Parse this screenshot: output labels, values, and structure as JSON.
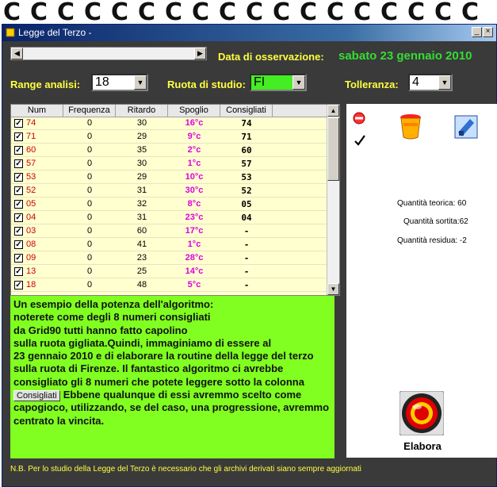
{
  "window": {
    "title": "Legge del Terzo -"
  },
  "header": {
    "date_label": "Data di osservazione:",
    "date_value": "sabato 23 gennaio 2010"
  },
  "controls": {
    "range_label": "Range analisi:",
    "range_value": "18",
    "ruota_label": "Ruota di studio:",
    "ruota_value": "FI",
    "tolleranza_label": "Tolleranza:",
    "tolleranza_value": "4"
  },
  "table": {
    "columns": [
      "Num",
      "Frequenza",
      "Ritardo",
      "Spoglio",
      "Consigliati"
    ],
    "rows": [
      {
        "num": "74",
        "freq": "0",
        "rit": "30",
        "spo": "16°c",
        "con": "74"
      },
      {
        "num": "71",
        "freq": "0",
        "rit": "29",
        "spo": "9°c",
        "con": "71"
      },
      {
        "num": "60",
        "freq": "0",
        "rit": "35",
        "spo": "2°c",
        "con": "60"
      },
      {
        "num": "57",
        "freq": "0",
        "rit": "30",
        "spo": "1°c",
        "con": "57"
      },
      {
        "num": "53",
        "freq": "0",
        "rit": "29",
        "spo": "10°c",
        "con": "53"
      },
      {
        "num": "52",
        "freq": "0",
        "rit": "31",
        "spo": "30°c",
        "con": "52"
      },
      {
        "num": "05",
        "freq": "0",
        "rit": "32",
        "spo": "8°c",
        "con": "05"
      },
      {
        "num": "04",
        "freq": "0",
        "rit": "31",
        "spo": "23°c",
        "con": "04"
      },
      {
        "num": "03",
        "freq": "0",
        "rit": "60",
        "spo": "17°c",
        "con": "-"
      },
      {
        "num": "08",
        "freq": "0",
        "rit": "41",
        "spo": "1°c",
        "con": "-"
      },
      {
        "num": "09",
        "freq": "0",
        "rit": "23",
        "spo": "28°c",
        "con": "-"
      },
      {
        "num": "13",
        "freq": "0",
        "rit": "25",
        "spo": "14°c",
        "con": "-"
      },
      {
        "num": "18",
        "freq": "0",
        "rit": "48",
        "spo": "5°c",
        "con": "-"
      }
    ]
  },
  "info": {
    "lines": [
      "Un esempio della potenza dell'algoritmo:",
      "noterete come degli 8 numeri consigliati",
      "da Grid90 tutti hanno fatto capolino",
      "sulla ruota gigliata.Quindi, immaginiamo di essere al",
      "23 gennaio 2010 e di elaborare la routine della legge del terzo",
      "sulla ruota di Firenze. Il fantastico algoritmo ci avrebbe",
      "consigliato gli 8 numeri che potete leggere sotto la colonna"
    ],
    "button_label": "Consigliati",
    "line_after_button": "Ebbene qualunque di essi avremmo scelto come",
    "tail_lines": [
      "capogioco, utilizzando, se del caso, una progressione, avremmo",
      "centrato la vincita."
    ]
  },
  "stats": {
    "teorica": "Quantità teorica: 60",
    "sortita": "Quantità sortita:62",
    "residua": "Quantità residua: -2"
  },
  "elabora_label": "Elabora",
  "footer": "N.B. Per lo studio della Legge del Terzo è necessario che gli archivi derivati siano sempre aggiornati",
  "icons": [
    "no-entry-icon",
    "check-icon",
    "bucket-icon",
    "blue-disk-icon",
    "elabora-icon",
    "minimize-icon",
    "close-icon"
  ],
  "colors": {
    "panel": "#3a3a3a",
    "label_yellow": "#ffff40",
    "date_green": "#33dd33",
    "note_green": "#80ff20",
    "grid_bg": "#ffffd0"
  }
}
